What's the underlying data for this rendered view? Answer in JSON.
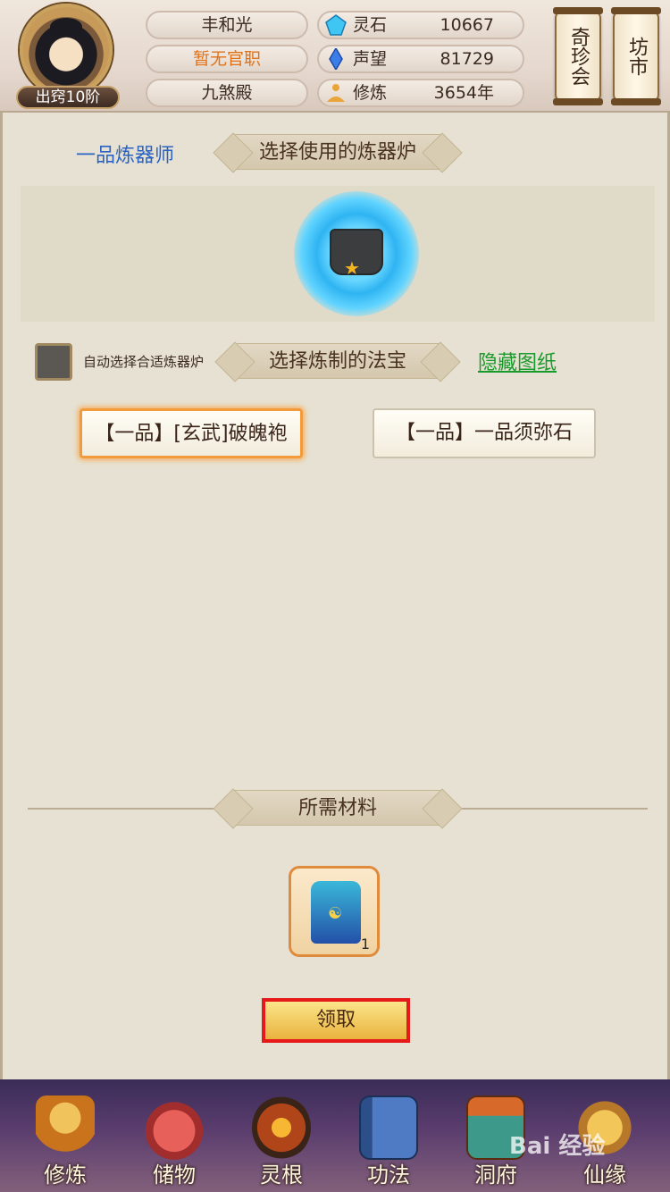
{
  "player": {
    "rank": "出窍10阶",
    "name": "丰和光",
    "official_title": "暂无官职",
    "sect": "九煞殿"
  },
  "resources": [
    {
      "icon": "spirit-stone-icon",
      "label": "灵石",
      "value": "10667"
    },
    {
      "icon": "reputation-crystal-icon",
      "label": "声望",
      "value": "81729"
    },
    {
      "icon": "meditation-icon",
      "label": "修炼",
      "value": "3654年"
    }
  ],
  "scroll_buttons": [
    "奇珍会",
    "坊市"
  ],
  "forge": {
    "grade_label": "一品炼器师",
    "choose_furnace_title": "选择使用的炼器炉",
    "auto_select_label": "自动选择合适炼器炉",
    "choose_treasure_title": "选择炼制的法宝",
    "hide_blueprints": "隐藏图纸",
    "treasures": [
      {
        "label": "【一品】[玄武]破魄袍",
        "selected": true
      },
      {
        "label": "【一品】一品须弥石",
        "selected": false
      }
    ],
    "materials_title": "所需材料",
    "material_count": "1",
    "claim_button": "领取"
  },
  "bottom_nav": [
    {
      "label": "修炼",
      "icon": "monk-icon"
    },
    {
      "label": "储物",
      "icon": "storage-bag-icon"
    },
    {
      "label": "灵根",
      "icon": "spirit-root-icon"
    },
    {
      "label": "功法",
      "icon": "scripture-book-icon"
    },
    {
      "label": "洞府",
      "icon": "cave-mansion-icon"
    },
    {
      "label": "仙缘",
      "icon": "gourd-icon"
    }
  ],
  "watermark": "Bai 经验"
}
